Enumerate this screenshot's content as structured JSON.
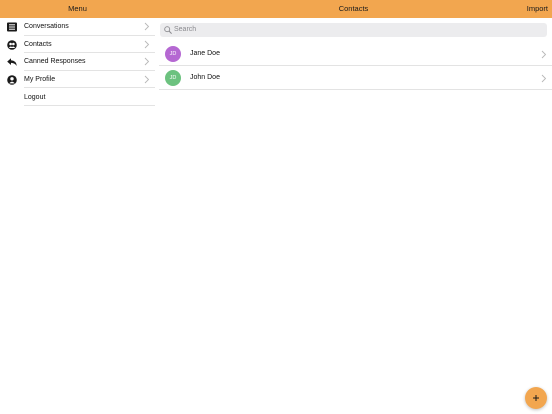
{
  "header": {
    "menu_title": "Menu",
    "contacts_title": "Contacts",
    "import_label": "Import",
    "bar_color": "#f2a64f"
  },
  "sidebar": {
    "items": [
      {
        "label": "Conversations",
        "icon": "list-icon"
      },
      {
        "label": "Contacts",
        "icon": "contacts-icon"
      },
      {
        "label": "Canned Responses",
        "icon": "reply-icon"
      },
      {
        "label": "My Profile",
        "icon": "profile-icon"
      },
      {
        "label": "Logout"
      }
    ]
  },
  "search": {
    "placeholder": "Search"
  },
  "contacts": [
    {
      "initials": "JD",
      "name": "Jane Doe",
      "avatar_color": "#b568d2"
    },
    {
      "initials": "JD",
      "name": "John Doe",
      "avatar_color": "#6cc27f"
    }
  ],
  "fab": {
    "label": "+",
    "color": "#f2a64f"
  }
}
